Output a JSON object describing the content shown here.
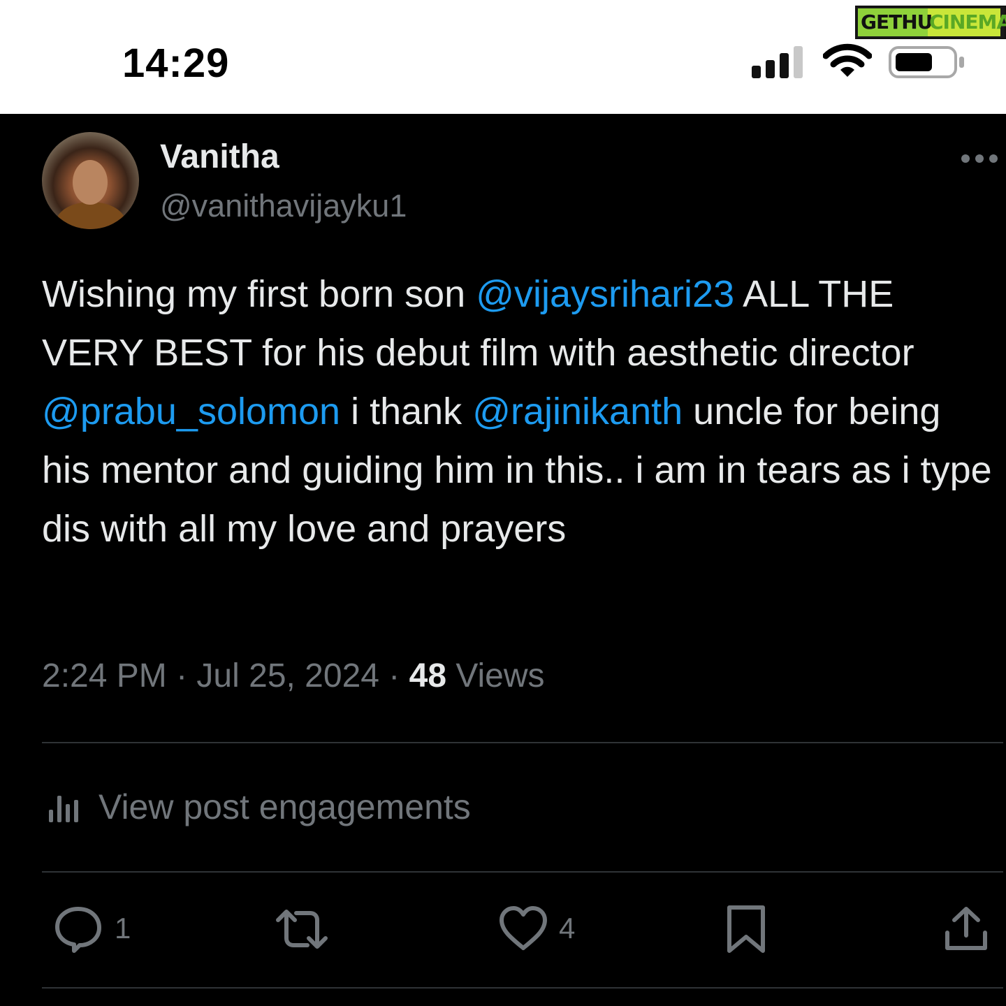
{
  "status_bar": {
    "time": "14:29",
    "signal_icon": "cellular-signal-icon",
    "wifi_icon": "wifi-icon",
    "battery_icon": "battery-icon"
  },
  "watermark": {
    "part1": "GETHU",
    "part2": "CINEMA"
  },
  "tweet": {
    "author_name": "Vanitha",
    "author_handle": "@vanithavijayku1",
    "more_icon": "more-options-icon",
    "text_segments": [
      {
        "text": "Wishing my first born son ",
        "type": "text"
      },
      {
        "text": "@vijaysrihari23",
        "type": "mention"
      },
      {
        "text": " ALL THE VERY BEST for his debut film with aesthetic director ",
        "type": "text"
      },
      {
        "text": "@prabu_solomon",
        "type": "mention"
      },
      {
        "text": " i thank ",
        "type": "text"
      },
      {
        "text": "@rajinikanth",
        "type": "mention"
      },
      {
        "text": " uncle for being his mentor and guiding him in this.. i am in tears as i type dis with all my love and prayers",
        "type": "text"
      }
    ],
    "time": "2:24 PM",
    "separator": " · ",
    "date": "Jul 25, 2024",
    "views_count": "48",
    "views_label": " Views",
    "engagements_label": "View post engagements",
    "actions": {
      "reply_count": "1",
      "retweet_count": "",
      "like_count": "4"
    }
  },
  "colors": {
    "background": "#000000",
    "text": "#e7e9ea",
    "secondary": "#71767b",
    "mention": "#1d9bf0",
    "divider": "#2f3336"
  }
}
